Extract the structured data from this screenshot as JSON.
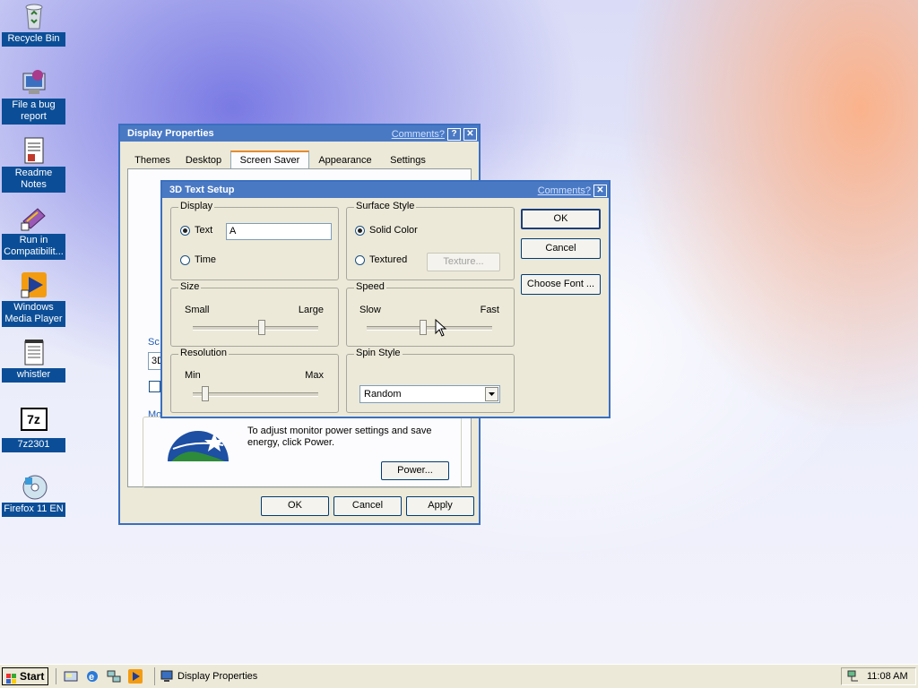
{
  "desktop": {
    "icons": [
      {
        "label": "Recycle Bin"
      },
      {
        "label": "File a bug report"
      },
      {
        "label": "Readme Notes"
      },
      {
        "label": "Run in Compatibilit..."
      },
      {
        "label": "Windows Media Player"
      },
      {
        "label": "whistler"
      },
      {
        "label": "7z2301"
      },
      {
        "label": "Firefox 11 EN"
      }
    ],
    "seven_zip_glyph": "7z"
  },
  "display_properties": {
    "title": "Display Properties",
    "comments": "Comments?",
    "help_glyph": "?",
    "close_glyph": "✕",
    "tabs": [
      "Themes",
      "Desktop",
      "Screen Saver",
      "Appearance",
      "Settings"
    ],
    "active_tab": "Screen Saver",
    "partial_screensaver_label": "Sc",
    "partial_screensaver_value": "3D",
    "partial_monitor_label": "Mo",
    "energy_text": "To adjust monitor power settings and save energy, click Power.",
    "power_button": "Power...",
    "ok": "OK",
    "cancel": "Cancel",
    "apply": "Apply"
  },
  "setup": {
    "title": "3D Text Setup",
    "comments": "Comments?",
    "close_glyph": "✕",
    "display_group": "Display",
    "text_option": "Text",
    "text_value": "A",
    "time_option": "Time",
    "surface_group": "Surface Style",
    "solid_color": "Solid Color",
    "textured": "Textured",
    "texture_button": "Texture...",
    "size_group": "Size",
    "size_min": "Small",
    "size_max": "Large",
    "size_level": 0.55,
    "speed_group": "Speed",
    "speed_min": "Slow",
    "speed_max": "Fast",
    "speed_level": 0.45,
    "resolution_group": "Resolution",
    "res_min": "Min",
    "res_max": "Max",
    "resolution_level": 0.1,
    "spin_group": "Spin Style",
    "spin_value": "Random",
    "ok": "OK",
    "cancel": "Cancel",
    "choose_font": "Choose Font ..."
  },
  "taskbar": {
    "start": "Start",
    "task": "Display Properties",
    "clock": "11:08 AM"
  },
  "colors": {
    "titlebar": "#4a79c4",
    "desktop_label_bg": "#0b4e97",
    "window_face": "#ece9d8"
  }
}
